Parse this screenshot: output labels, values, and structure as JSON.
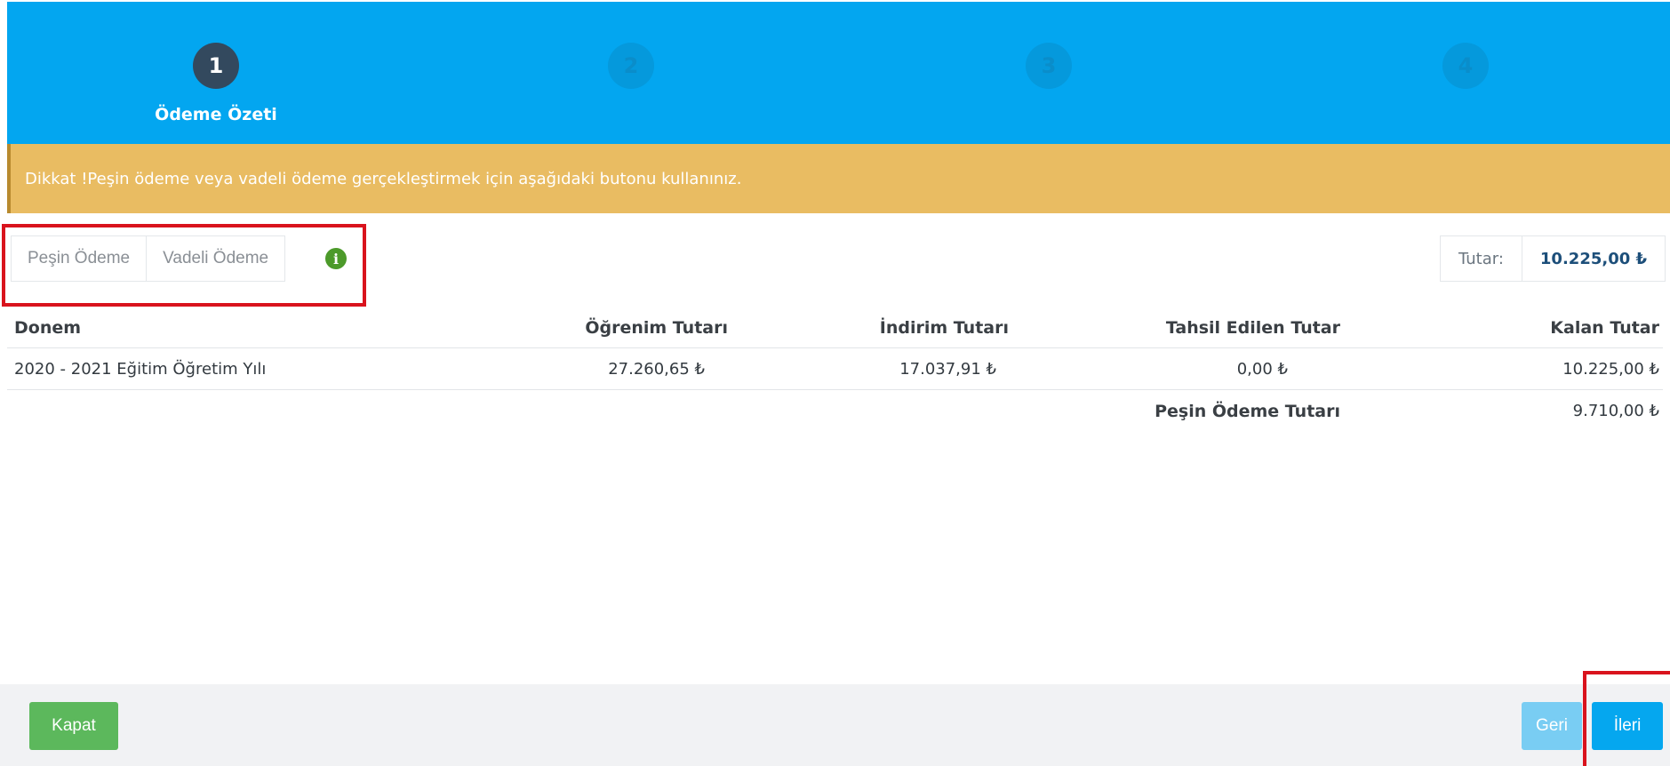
{
  "wizard": {
    "steps": [
      {
        "number": "1",
        "title": "Ödeme Özeti",
        "active": true
      },
      {
        "number": "2",
        "title": "",
        "active": false
      },
      {
        "number": "3",
        "title": "",
        "active": false
      },
      {
        "number": "4",
        "title": "",
        "active": false
      }
    ]
  },
  "alert": {
    "text": "Dikkat !Peşin ödeme veya vadeli ödeme gerçekleştirmek için aşağıdaki butonu kullanınız."
  },
  "payment_options": {
    "cash_label": "Peşin Ödeme",
    "installment_label": "Vadeli Ödeme",
    "info_icon": "info-circle-icon"
  },
  "amount": {
    "label": "Tutar:",
    "value": "10.225,00 ₺"
  },
  "table": {
    "headers": [
      "Donem",
      "Öğrenim Tutarı",
      "İndirim Tutarı",
      "Tahsil Edilen Tutar",
      "Kalan Tutar"
    ],
    "rows": [
      [
        "2020 - 2021 Eğitim Öğretim Yılı",
        "27.260,65 ₺",
        "17.037,91 ₺",
        "0,00 ₺",
        "10.225,00 ₺"
      ]
    ],
    "summary_label": "Peşin Ödeme Tutarı",
    "summary_value": "9.710,00 ₺"
  },
  "footer": {
    "close_label": "Kapat",
    "back_label": "Geri",
    "next_label": "İleri"
  },
  "colors": {
    "wizard_bg": "#03a6f0",
    "alert_bg": "#e9bc62",
    "close_button": "#5cb85c",
    "next_button": "#05a7ef",
    "highlight": "#d9131d"
  }
}
